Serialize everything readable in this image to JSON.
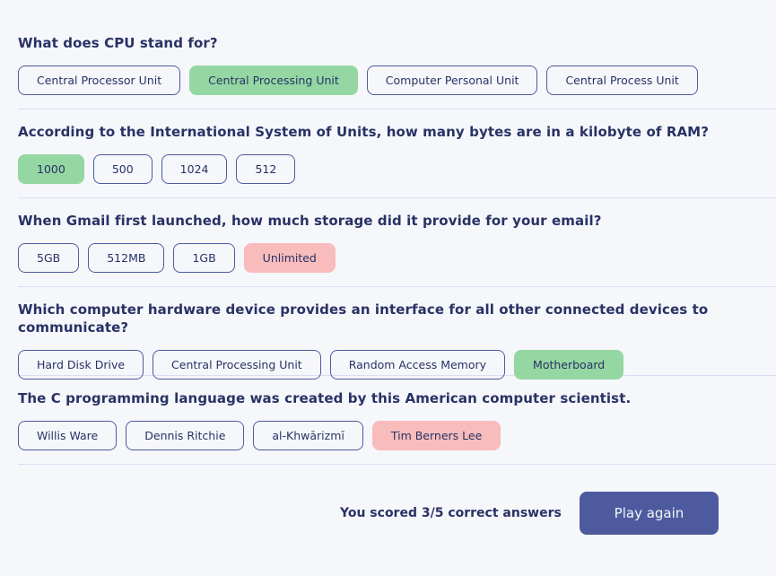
{
  "questions": [
    {
      "text": "What does CPU stand for?",
      "answers": [
        {
          "label": "Central Processor Unit",
          "state": "neutral"
        },
        {
          "label": "Central Processing Unit",
          "state": "correct"
        },
        {
          "label": "Computer Personal Unit",
          "state": "neutral"
        },
        {
          "label": "Central Process Unit",
          "state": "neutral"
        }
      ]
    },
    {
      "text": "According to the International System of Units, how many bytes are in a kilobyte of RAM?",
      "answers": [
        {
          "label": "1000",
          "state": "correct"
        },
        {
          "label": "500",
          "state": "neutral"
        },
        {
          "label": "1024",
          "state": "neutral"
        },
        {
          "label": "512",
          "state": "neutral"
        }
      ]
    },
    {
      "text": "When Gmail first launched, how much storage did it provide for your email?",
      "answers": [
        {
          "label": "5GB",
          "state": "neutral"
        },
        {
          "label": "512MB",
          "state": "neutral"
        },
        {
          "label": "1GB",
          "state": "neutral"
        },
        {
          "label": "Unlimited",
          "state": "wrong"
        }
      ]
    },
    {
      "text": "Which computer hardware device provides an interface for all other connected devices to communicate?",
      "answers": [
        {
          "label": "Hard Disk Drive",
          "state": "neutral"
        },
        {
          "label": "Central Processing Unit",
          "state": "neutral"
        },
        {
          "label": "Random Access Memory",
          "state": "neutral"
        },
        {
          "label": "Motherboard",
          "state": "correct"
        }
      ]
    },
    {
      "text": "The C programming language was created by this American computer scientist.",
      "answers": [
        {
          "label": "Willis Ware",
          "state": "neutral"
        },
        {
          "label": "Dennis Ritchie",
          "state": "neutral"
        },
        {
          "label": "al-Khwārizmī",
          "state": "neutral"
        },
        {
          "label": "Tim Berners Lee",
          "state": "wrong"
        }
      ]
    }
  ],
  "footer": {
    "score_text": "You scored 3/5 correct answers",
    "play_again_label": "Play again"
  },
  "colors": {
    "text": "#293264",
    "accent": "#4d5b9e",
    "correct": "#94d7a2",
    "wrong": "#f8bcbc",
    "background": "#f5f7fb"
  }
}
